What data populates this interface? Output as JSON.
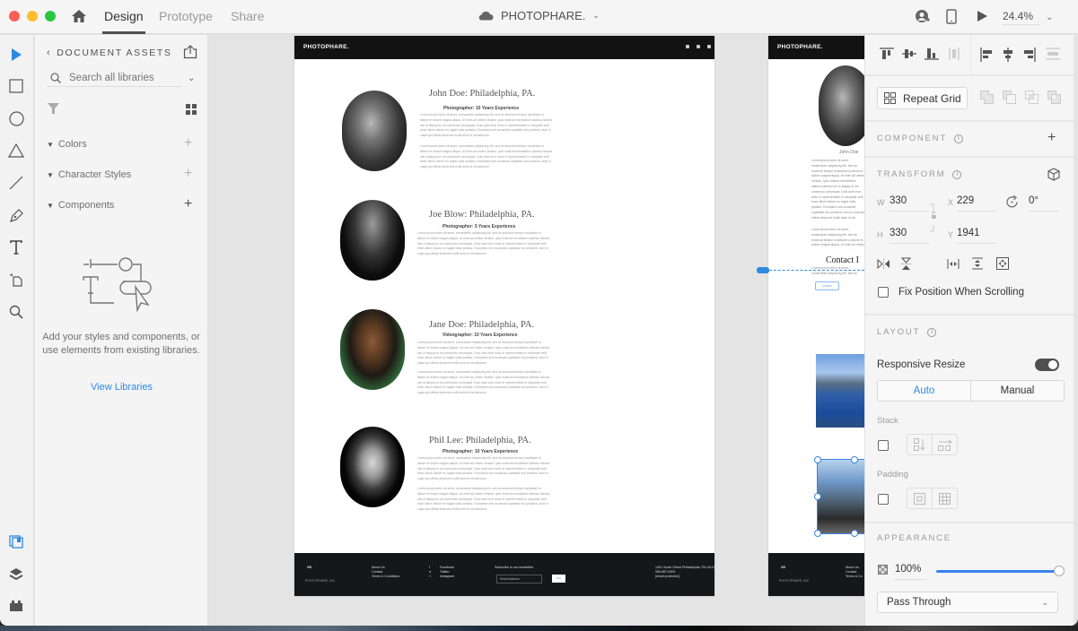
{
  "titlebar": {
    "tabs": [
      {
        "label": "Design",
        "active": true
      },
      {
        "label": "Prototype",
        "active": false
      },
      {
        "label": "Share",
        "active": false
      }
    ],
    "document_title": "PHOTOPHARE.",
    "zoom": "24.4%",
    "icons": [
      "home-icon",
      "cloud-icon",
      "invite-user-icon",
      "device-preview-icon",
      "play-icon",
      "chevron-down-icon"
    ]
  },
  "tools": [
    "select-tool",
    "rectangle-tool",
    "ellipse-tool",
    "polygon-tool",
    "line-tool",
    "pen-tool",
    "text-tool",
    "artboard-tool",
    "zoom-tool",
    "assets-tab",
    "layers-tab",
    "plugins-tab"
  ],
  "assets": {
    "header": "DOCUMENT ASSETS",
    "search_placeholder": "Search all libraries",
    "sections": [
      {
        "label": "Colors"
      },
      {
        "label": "Character Styles"
      },
      {
        "label": "Components"
      }
    ],
    "empty_text": "Add your styles and components, or use elements from existing libraries.",
    "view_libraries": "View Libraries"
  },
  "artboard_main": {
    "logo": "PHOTOPHARE.",
    "people": [
      {
        "name": "John Doe: Philadelphia, PA.",
        "role": "Photographer: 10 Years Experience",
        "paragraphs": 2
      },
      {
        "name": "Joe Blow: Philadelphia, PA.",
        "role": "Photographer: 5 Years Experience",
        "paragraphs": 1
      },
      {
        "name": "Jane Doe: Philadelphia, PA.",
        "role": "Videographer: 10 Years Experience",
        "paragraphs": 2
      },
      {
        "name": "Phil Lee: Philadelphia, PA.",
        "role": "Photographer: 10 Years Experience",
        "paragraphs": 2
      }
    ],
    "lorem": "Lorem ipsum dolor sit amet, consectetur adipiscing elit, sed do eiusmod tempor incididunt ut labore et dolore magna aliqua. Ut enim ad minim veniam, quis nostrud exercitation ullamco laboris nisi ut aliquip ex ea commodo consequat. Duis aute irure dolor in reprehenderit in voluptate velit esse cillum dolore eu fugiat nulla pariatur. Excepteur sint occaecat cupidatat non proident, sunt in culpa qui officia deserunt mollit anim id est laborum.",
    "footer": {
      "brand": "XB",
      "copyright": "PHOTOPHARE, INC.",
      "links": [
        "About Us",
        "Contact",
        "Terms & Conditions"
      ],
      "social": [
        "Facebook",
        "Twitter",
        "Instagram"
      ],
      "newsletter_label": "Subscribe to our newsletter",
      "email_placeholder": "Email Address",
      "submit": "GO",
      "address": "1401 South Street Philadelphia, PA 19147",
      "phone": "555-867-5309",
      "email": "[email protected]"
    }
  },
  "artboard_second": {
    "logo": "PHOTOPHARE.",
    "caption": "John Doe",
    "contact_heading": "Contact I",
    "button": "SUBMIT",
    "footer_brand": "XB",
    "footer_copyright": "PHOTOPHARE, INC.",
    "footer_links": [
      "About Us",
      "Contact",
      "Terms & Co"
    ]
  },
  "properties": {
    "repeat_grid": "Repeat Grid",
    "component_label": "COMPONENT",
    "transform_label": "TRANSFORM",
    "w_label": "W",
    "w": "330",
    "h_label": "H",
    "h": "330",
    "x_label": "X",
    "x": "229",
    "y_label": "Y",
    "y": "1941",
    "rotation": "0°",
    "fix_position": "Fix Position When Scrolling",
    "fix_position_checked": false,
    "layout_label": "LAYOUT",
    "responsive_resize": "Responsive Resize",
    "responsive_resize_on": true,
    "resize_modes": [
      {
        "label": "Auto",
        "active": true
      },
      {
        "label": "Manual",
        "active": false
      }
    ],
    "stack_label": "Stack",
    "padding_label": "Padding",
    "appearance_label": "APPEARANCE",
    "opacity": "100%",
    "opacity_value": 1.0,
    "blend_mode": "Pass Through"
  },
  "colors": {
    "accent": "#2d8ae1",
    "traffic_red": "#fe5f57",
    "traffic_yellow": "#febc2e",
    "traffic_green": "#28c840",
    "artboard_nav": "#121212"
  }
}
